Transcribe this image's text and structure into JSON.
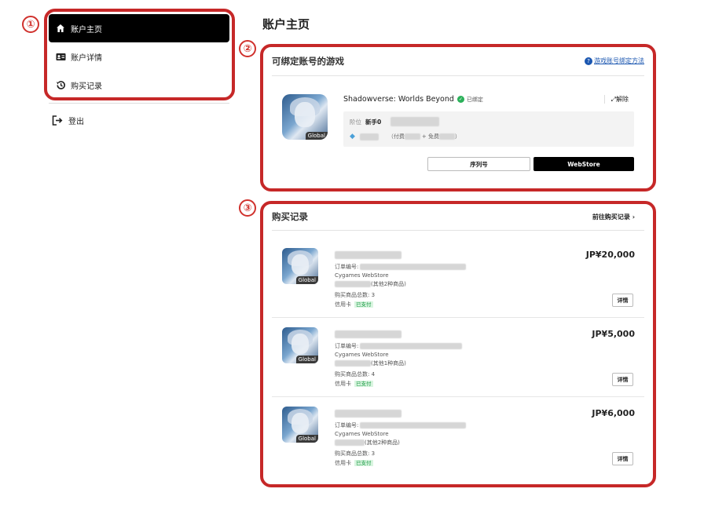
{
  "callouts": [
    "①",
    "②",
    "③"
  ],
  "sidebar": {
    "items": [
      {
        "label": "账户主页",
        "icon": "home-icon",
        "active": true
      },
      {
        "label": "账户详情",
        "icon": "id-card-icon",
        "active": false
      },
      {
        "label": "购买记录",
        "icon": "history-icon",
        "active": false
      }
    ],
    "logout_label": "登出"
  },
  "page_title": "账户主页",
  "games_card": {
    "title": "可绑定账号的游戏",
    "help_link": "游戏账号绑定方法",
    "help_icon": "?",
    "game": {
      "icon_tag": "Global",
      "name": "Shadowverse: Worlds Beyond",
      "bound_label": "已绑定",
      "unbind_label": "⤢解除",
      "rank_label": "阶位",
      "rank_value": "新手0",
      "currency_paid": "（付费",
      "currency_free": "+ 免费",
      "currency_close": "）"
    },
    "serial_button": "序列号",
    "webstore_button": "WebStore"
  },
  "orders_card": {
    "title": "购买记录",
    "more_link": "前往购买记录 ›",
    "orders": [
      {
        "icon_tag": "Global",
        "price": "JP¥20,000",
        "order_no_label": "订单编号:",
        "store": "Cygames WebStore",
        "others": "(其他2种商品)",
        "total": "购买商品总数: 3",
        "payment": "信用卡",
        "status": "已支付",
        "detail": "详情"
      },
      {
        "icon_tag": "Global",
        "price": "JP¥5,000",
        "order_no_label": "订单编号:",
        "store": "Cygames WebStore",
        "others": "(其他1种商品)",
        "total": "购买商品总数: 4",
        "payment": "信用卡",
        "status": "已支付",
        "detail": "详情"
      },
      {
        "icon_tag": "Global",
        "price": "JP¥6,000",
        "order_no_label": "订单编号:",
        "store": "Cygames WebStore",
        "others": "(其他2种商品)",
        "total": "购买商品总数: 3",
        "payment": "信用卡",
        "status": "已支付",
        "detail": "详情"
      }
    ]
  },
  "colors": {
    "annotation_red": "#c62828",
    "link_blue": "#1a56b0",
    "paid_green": "#1d9a46"
  }
}
